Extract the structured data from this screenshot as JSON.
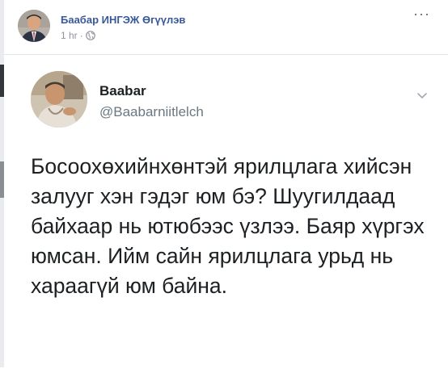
{
  "post": {
    "author_name": "Баабар ИНГЭЖ Өгүүлэв",
    "time": "1 hr",
    "separator": "·",
    "visibility_icon": "globe-icon",
    "more_icon": "more-horizontal-icon",
    "more_glyph": "···"
  },
  "tweet": {
    "display_name": "Baabar",
    "handle": "@Baabarniitlelch",
    "menu_icon": "chevron-down-icon",
    "text": "Босоохөхийнхөнтэй ярилцлага хийсэн залууг хэн гэдэг юм бэ? Шуугилдаад байхаар нь ютюбээс үзлээ. Баяр хүргэх юмсан. Ийм сайн ярилцлага урьд нь хараагүй юм байна."
  },
  "colors": {
    "facebook_link": "#385898",
    "meta_gray": "#90949c",
    "tweet_text": "#1c2022",
    "tweet_handle": "#697882"
  }
}
